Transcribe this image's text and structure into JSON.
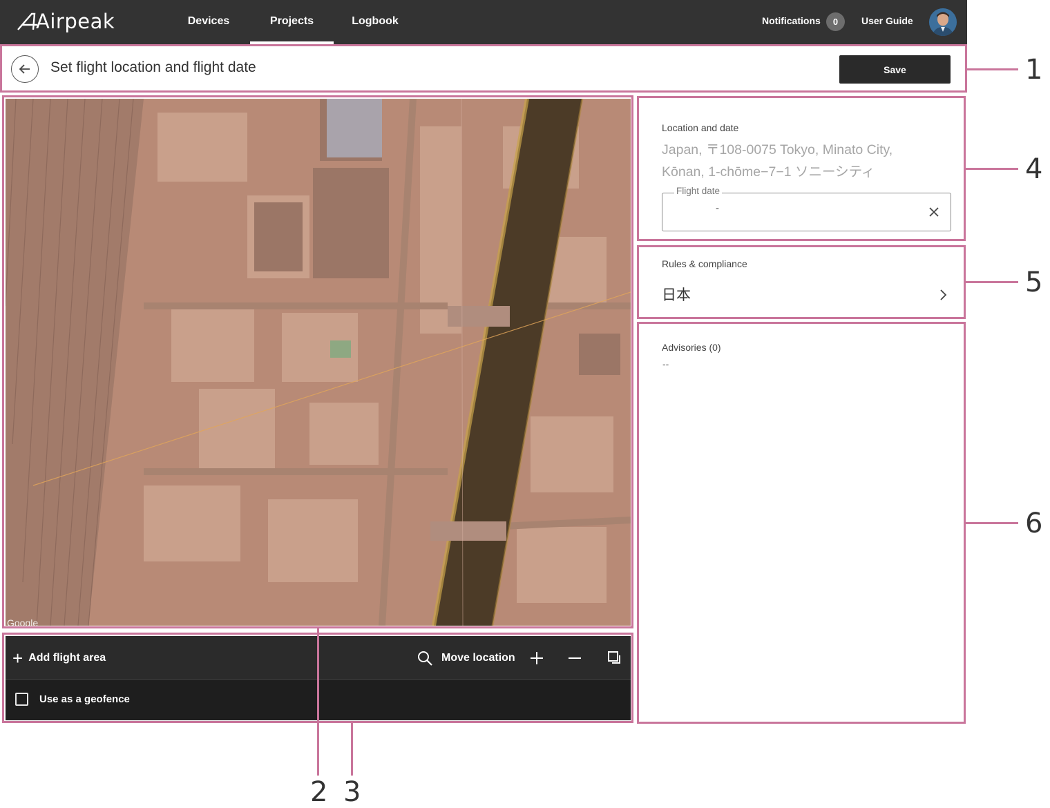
{
  "app": {
    "brand": "Airpeak"
  },
  "nav": {
    "items": [
      {
        "label": "Devices"
      },
      {
        "label": "Projects",
        "active": true
      },
      {
        "label": "Logbook"
      }
    ],
    "notifications_label": "Notifications",
    "notifications_count": "0",
    "user_guide": "User Guide"
  },
  "header": {
    "title": "Set flight location and flight date",
    "save_label": "Save"
  },
  "map": {
    "credit": "Google"
  },
  "toolbar": {
    "add_flight_area": "Add flight area",
    "move_location": "Move location",
    "use_as_geofence": "Use as a geofence",
    "geofence_checked": false
  },
  "location_panel": {
    "label": "Location and date",
    "address_line1": "Japan, 〒108-0075 Tokyo, Minato City,",
    "address_line2": "Kōnan, 1-chōme−7−1 ソニーシティ",
    "flight_date_label": "Flight date",
    "flight_date_value": "-"
  },
  "rules_panel": {
    "label": "Rules & compliance",
    "value": "日本"
  },
  "advisories_panel": {
    "label": "Advisories (0)",
    "value": "--"
  },
  "callouts": [
    "1",
    "2",
    "3",
    "4",
    "5",
    "6"
  ],
  "colors": {
    "topbar": "#333333",
    "accent_frame": "#c9759b",
    "toolbar": "#2b2b2b",
    "save_button": "#2a2a2a"
  }
}
